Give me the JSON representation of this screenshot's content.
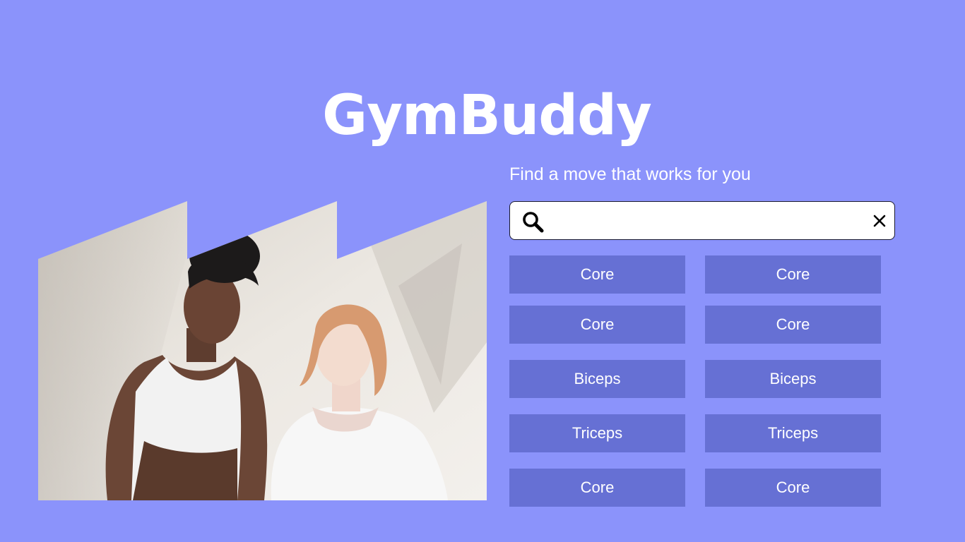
{
  "app": {
    "title": "GymBuddy"
  },
  "colors": {
    "background": "#8b93fb",
    "chip": "#6670d4",
    "text": "#ffffff"
  },
  "hero": {
    "image": "two-women-in-white-tops-photo"
  },
  "search": {
    "tagline": "Find a move that works for you",
    "value": "",
    "placeholder": "",
    "search_icon": "search-icon",
    "clear_icon": "close-icon"
  },
  "categories": [
    "Core",
    "Core",
    "Core",
    "Core",
    "Biceps",
    "Biceps",
    "Triceps",
    "Triceps",
    "Core",
    "Core"
  ]
}
